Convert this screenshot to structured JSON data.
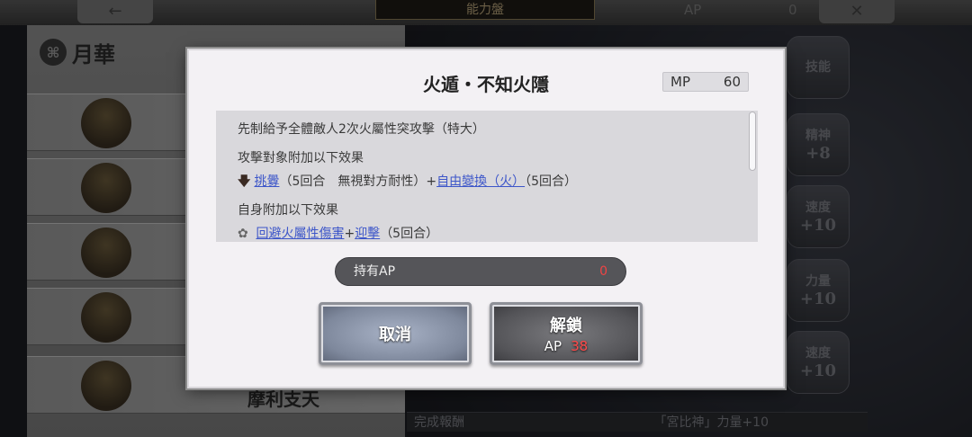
{
  "background": {
    "ability_board_label": "能力盤",
    "ap_label": "AP",
    "ap_value": "0",
    "back_icon": "←",
    "close_icon": "✕",
    "character_name": "月華",
    "character_icon": "⌘",
    "roster_bottom_name": "摩利支天",
    "side_stats": [
      {
        "label": "技能",
        "value": ""
      },
      {
        "label": "精神",
        "value": "+8"
      },
      {
        "label": "速度",
        "value": "+10"
      },
      {
        "label": "力量",
        "value": "+10"
      },
      {
        "label": "速度",
        "value": "+10"
      }
    ],
    "reward_label": "完成報酬",
    "reward_text": "「宮比神」力量+10"
  },
  "dialog": {
    "title": "火遁・不知火隱",
    "mp_label": "MP",
    "mp_value": "60",
    "description": {
      "line1": "先制給予全體敵人2次火屬性突攻擊（特大）",
      "target_header": "攻擊對象附加以下效果",
      "debuff_icon": "🡇",
      "debuff_link1": "挑釁",
      "debuff_mid": "（5回合　無視對方耐性）+",
      "debuff_link2": "自由變換（火）",
      "debuff_end": "（5回合）",
      "self_header": "自身附加以下效果",
      "buff_icon": "✿",
      "buff_link1": "回避火屬性傷害",
      "buff_plus": "+",
      "buff_link2": "迎擊",
      "buff_end": "（5回合）"
    },
    "held_ap_label": "持有AP",
    "held_ap_value": "0",
    "cancel_label": "取消",
    "unlock_label": "解鎖",
    "unlock_cost_label": "AP",
    "unlock_cost_value": "38"
  }
}
